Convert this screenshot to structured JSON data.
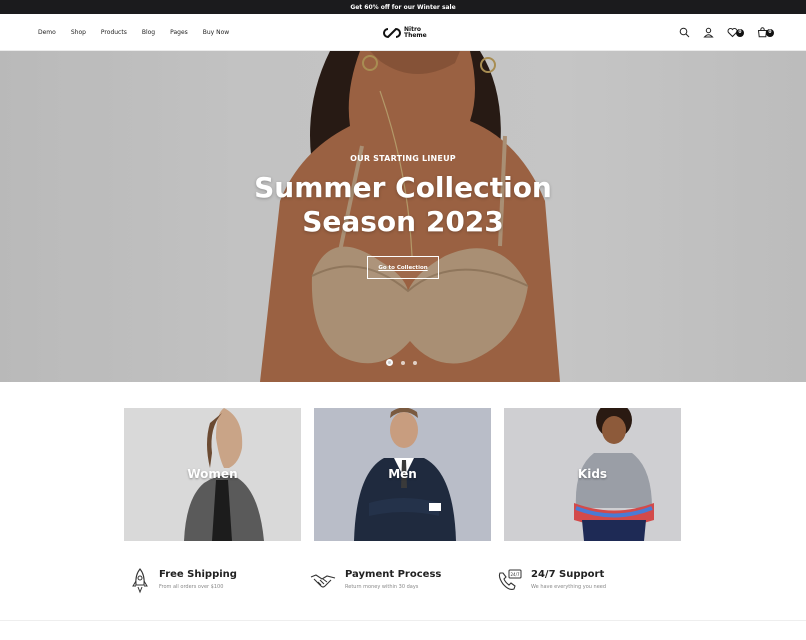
{
  "promo_bar": {
    "text": "Get 60% off for our Winter sale"
  },
  "nav": {
    "items": [
      "Demo",
      "Shop",
      "Products",
      "Blog",
      "Pages",
      "Buy Now"
    ]
  },
  "logo": {
    "line1": "Nitro",
    "line2": "Theme"
  },
  "header_actions": {
    "icons": [
      "search-icon",
      "user-icon",
      "heart-icon",
      "cart-icon"
    ],
    "wishlist_count": "0",
    "cart_count": "0"
  },
  "hero": {
    "kicker": "OUR STARTING LINEUP",
    "title_line1": "Summer Collection",
    "title_line2": "Season 2023",
    "button_label": "Go to Collection",
    "slides": 3,
    "active_slide": 1
  },
  "categories": [
    {
      "label": "Women"
    },
    {
      "label": "Men"
    },
    {
      "label": "Kids"
    }
  ],
  "features": [
    {
      "icon": "rocket-icon",
      "title": "Free Shipping",
      "subtitle": "From all orders over $100"
    },
    {
      "icon": "handshake-icon",
      "title": "Payment Process",
      "subtitle": "Return money within 30 days"
    },
    {
      "icon": "support-phone-icon",
      "title": "24/7 Support",
      "subtitle": "We have everything you need"
    }
  ],
  "colors": {
    "promo_bg": "#1b1b1d",
    "text_dark": "#222222",
    "muted": "#888888",
    "hero_bg": "#d3d3d3"
  }
}
